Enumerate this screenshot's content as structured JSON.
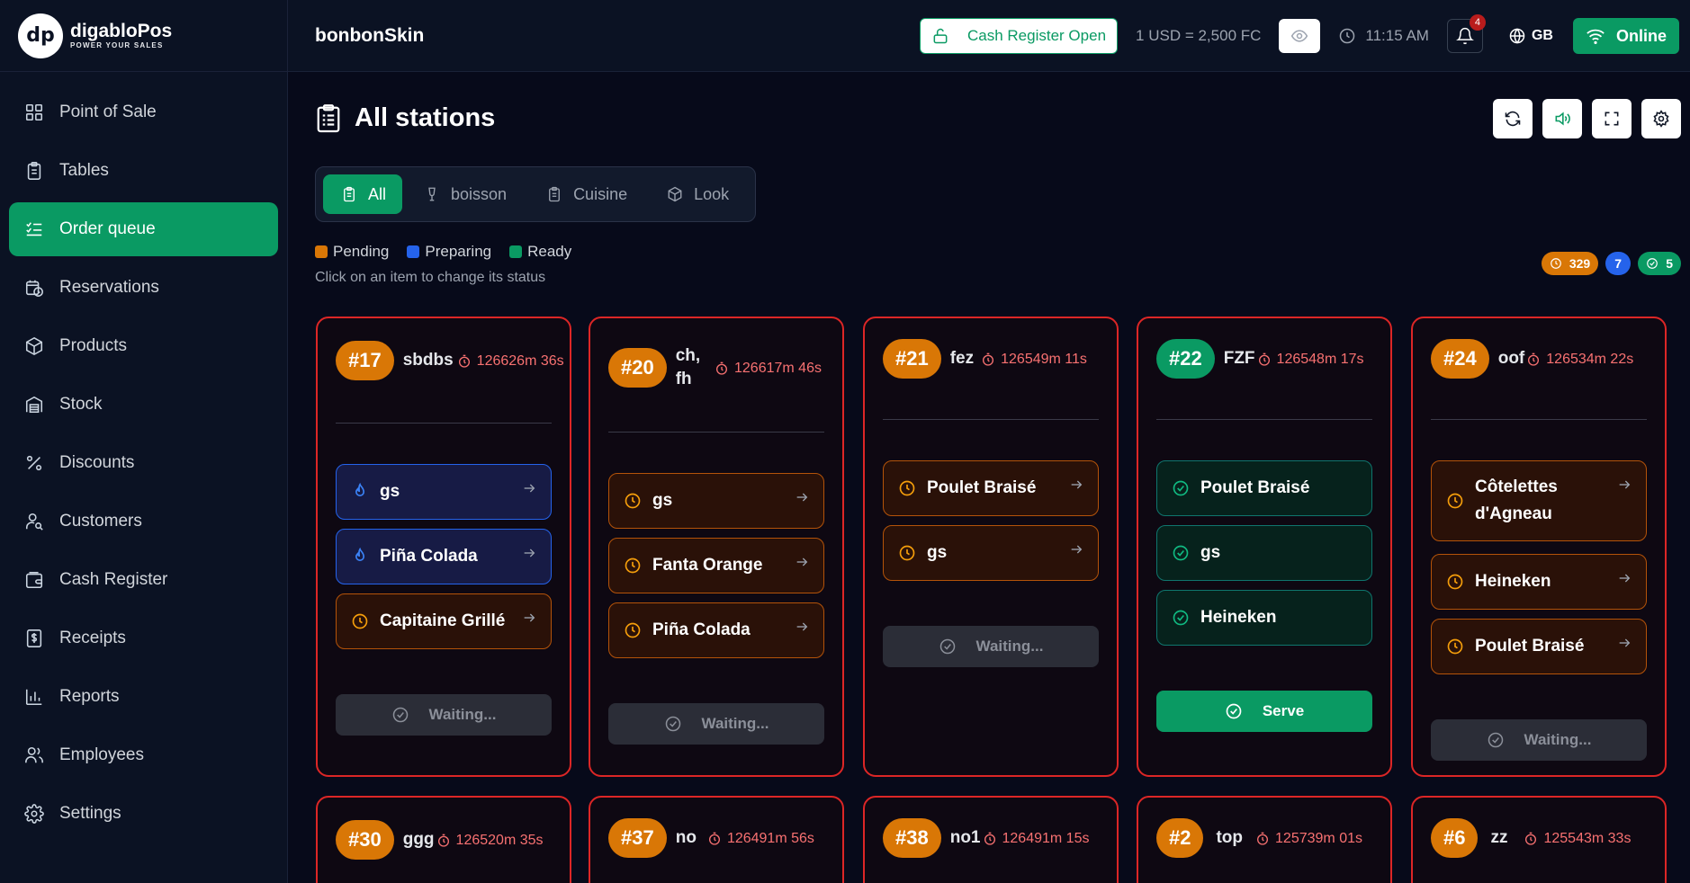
{
  "brand": {
    "logo_text": "dp",
    "name": "digabloPos",
    "tagline": "POWER YOUR SALES"
  },
  "sidebar": {
    "items": [
      {
        "label": "Point of Sale",
        "icon": "grid-icon"
      },
      {
        "label": "Tables",
        "icon": "clipboard-icon"
      },
      {
        "label": "Order queue",
        "icon": "list-check-icon",
        "active": true
      },
      {
        "label": "Reservations",
        "icon": "calendar-clock-icon"
      },
      {
        "label": "Products",
        "icon": "box-icon"
      },
      {
        "label": "Stock",
        "icon": "warehouse-icon"
      },
      {
        "label": "Discounts",
        "icon": "percent-icon"
      },
      {
        "label": "Customers",
        "icon": "user-search-icon"
      },
      {
        "label": "Cash Register",
        "icon": "wallet-icon"
      },
      {
        "label": "Receipts",
        "icon": "receipt-icon"
      },
      {
        "label": "Reports",
        "icon": "bar-chart-icon"
      },
      {
        "label": "Employees",
        "icon": "users-icon"
      },
      {
        "label": "Settings",
        "icon": "gear-icon"
      }
    ]
  },
  "header": {
    "store_name": "bonbonSkin",
    "cash_register": "Cash Register Open",
    "exchange_rate": "1 USD = 2,500 FC",
    "time": "11:15 AM",
    "notifications": "4",
    "language": "GB",
    "status": "Online"
  },
  "main": {
    "title": "All stations",
    "tabs": [
      {
        "label": "All",
        "icon": "clipboard-icon",
        "active": true
      },
      {
        "label": "boisson",
        "icon": "wine-glass-icon"
      },
      {
        "label": "Cuisine",
        "icon": "clipboard-icon"
      },
      {
        "label": "Look",
        "icon": "box-icon"
      }
    ],
    "legend": [
      {
        "label": "Pending",
        "color": "#d97706"
      },
      {
        "label": "Preparing",
        "color": "#2563eb"
      },
      {
        "label": "Ready",
        "color": "#0a9a63"
      }
    ],
    "hint": "Click on an item to change its status",
    "counts": {
      "pending": "329",
      "preparing": "7",
      "ready": "5"
    }
  },
  "buttons": {
    "waiting": "Waiting...",
    "serve": "Serve"
  },
  "orders": [
    {
      "number": "#17",
      "table": "sbdbs",
      "timer": "126626m 36s",
      "items": [
        {
          "name": "gs",
          "status": "preparing"
        },
        {
          "name": "Piña Colada",
          "status": "preparing"
        },
        {
          "name": "Capitaine Grillé",
          "status": "pending"
        }
      ],
      "action": "waiting"
    },
    {
      "number": "#20",
      "table": "ch, fh",
      "timer": "126617m 46s",
      "items": [
        {
          "name": "gs",
          "status": "pending"
        },
        {
          "name": "Fanta Orange",
          "status": "pending"
        },
        {
          "name": "Piña Colada",
          "status": "pending"
        }
      ],
      "action": "waiting"
    },
    {
      "number": "#21",
      "table": "fez",
      "timer": "126549m 11s",
      "items": [
        {
          "name": "Poulet Braisé",
          "status": "pending"
        },
        {
          "name": "gs",
          "status": "pending"
        }
      ],
      "action": "waiting"
    },
    {
      "number": "#22",
      "table": "FZF",
      "timer": "126548m 17s",
      "items": [
        {
          "name": "Poulet Braisé",
          "status": "ready"
        },
        {
          "name": "gs",
          "status": "ready"
        },
        {
          "name": "Heineken",
          "status": "ready"
        }
      ],
      "action": "serve"
    },
    {
      "number": "#24",
      "table": "oof",
      "timer": "126534m 22s",
      "items": [
        {
          "name": "Côtelettes d'Agneau",
          "status": "pending"
        },
        {
          "name": "Heineken",
          "status": "pending"
        },
        {
          "name": "Poulet Braisé",
          "status": "pending"
        }
      ],
      "action": "waiting"
    },
    {
      "number": "#30",
      "table": "ggg",
      "timer": "126520m 35s"
    },
    {
      "number": "#37",
      "table": "no",
      "timer": "126491m 56s"
    },
    {
      "number": "#38",
      "table": "no1",
      "timer": "126491m 15s"
    },
    {
      "number": "#2",
      "table": "top",
      "timer": "125739m 01s"
    },
    {
      "number": "#6",
      "table": "zz",
      "timer": "125543m 33s"
    }
  ]
}
